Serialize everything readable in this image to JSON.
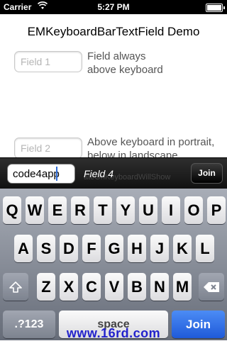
{
  "status_bar": {
    "carrier": "Carrier",
    "time": "5:27 PM"
  },
  "page": {
    "title": "EMKeyboardBarTextField Demo",
    "field1": {
      "placeholder": "Field 1",
      "desc_line1": "Field always",
      "desc_line2": "above keyboard"
    },
    "field2": {
      "placeholder": "Field 2",
      "desc_line1": "Above keyboard in portrait,",
      "desc_line2": "below in landscape"
    }
  },
  "keyboard_bar": {
    "input_value": "code4app",
    "field_label": "Field 4",
    "ghost_text": "ateOnKeyboardWillShow",
    "join_label": "Join"
  },
  "keyboard": {
    "row1": [
      "Q",
      "W",
      "E",
      "R",
      "T",
      "Y",
      "U",
      "I",
      "O",
      "P"
    ],
    "row2": [
      "A",
      "S",
      "D",
      "F",
      "G",
      "H",
      "J",
      "K",
      "L"
    ],
    "row3": [
      "Z",
      "X",
      "C",
      "V",
      "B",
      "N",
      "M"
    ],
    "numbers_label": ".?123",
    "space_label": "space",
    "return_label": "Join"
  },
  "watermark": "www.16rd.com",
  "colors": {
    "return_key": "#2f6ff0",
    "caret": "#2f6cd6",
    "watermark": "#2222cc"
  }
}
